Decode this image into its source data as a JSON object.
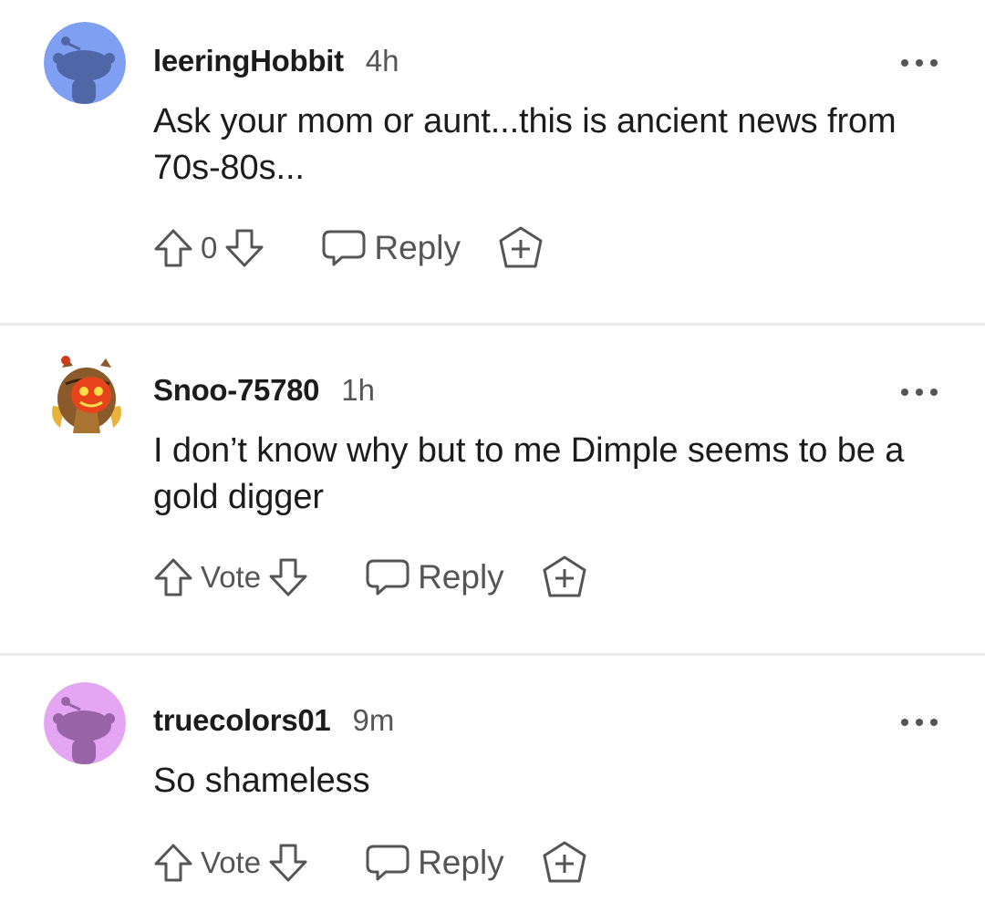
{
  "comments": [
    {
      "username": "leeringHobbit",
      "time": "4h",
      "text": "Ask your mom or aunt...this is ancient news from 70s-80s...",
      "vote_label": "0",
      "reply_label": "Reply",
      "avatar_color": "#7f9ff2"
    },
    {
      "username": "Snoo-75780",
      "time": "1h",
      "text": "I don’t know why but to me Dimple seems to be a gold digger",
      "vote_label": "Vote",
      "reply_label": "Reply",
      "avatar_color": "custom-owl"
    },
    {
      "username": "truecolors01",
      "time": "9m",
      "text": "So shameless",
      "vote_label": "Vote",
      "reply_label": "Reply",
      "avatar_color": "#e4a6f2"
    }
  ],
  "icons": {
    "upvote": "arrow-up-outline",
    "downvote": "arrow-down-outline",
    "reply": "speech-bubble",
    "award": "plus-hexagon",
    "more": "ellipsis-horizontal"
  }
}
